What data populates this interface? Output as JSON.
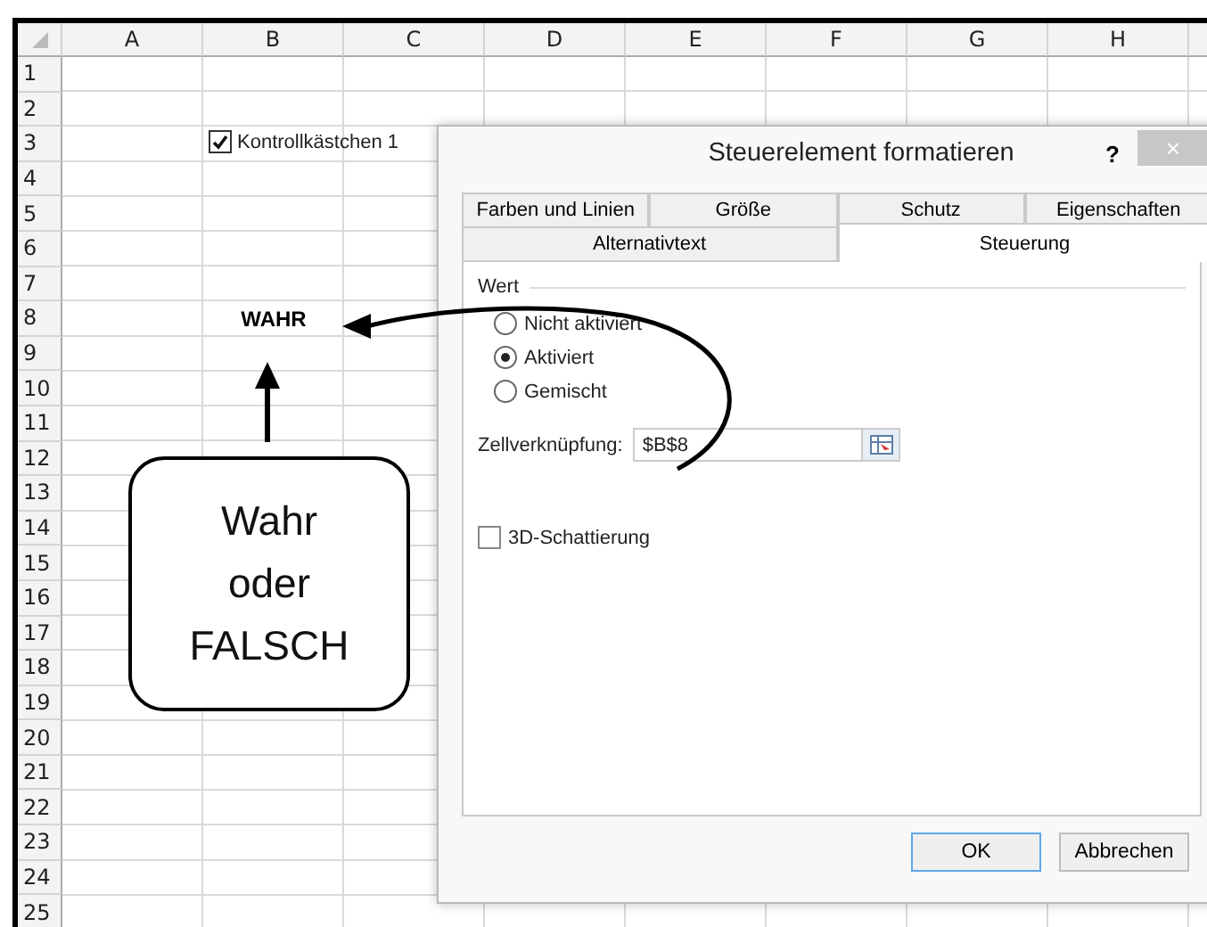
{
  "sheet": {
    "columns": [
      "A",
      "B",
      "C",
      "D",
      "E",
      "F",
      "G",
      "H"
    ],
    "rows": [
      "1",
      "2",
      "3",
      "4",
      "5",
      "6",
      "7",
      "8",
      "9",
      "10",
      "11",
      "12",
      "13",
      "14",
      "15",
      "16",
      "17",
      "18",
      "19",
      "20",
      "21",
      "22",
      "23",
      "24",
      "25"
    ],
    "checkbox_control": {
      "label": "Kontrollkästchen 1",
      "checked": true
    },
    "linked_cell": "WAHR"
  },
  "callout": {
    "lines": [
      "Wahr",
      "oder",
      "FALSCH"
    ]
  },
  "dialog": {
    "title": "Steuerelement formatieren",
    "help": "?",
    "close": "×",
    "tab_rows": [
      [
        {
          "label": "Farben und Linien",
          "selected": false
        },
        {
          "label": "Größe",
          "selected": false
        },
        {
          "label": "Schutz",
          "selected": false
        },
        {
          "label": "Eigenschaften",
          "selected": false
        }
      ],
      [
        {
          "label": "Alternativtext",
          "selected": false
        },
        {
          "label": "Steuerung",
          "selected": true
        }
      ]
    ],
    "group": "Wert",
    "radios": [
      {
        "label": "Nicht aktiviert",
        "selected": false
      },
      {
        "label": "Aktiviert",
        "selected": true
      },
      {
        "label": "Gemischt",
        "selected": false
      }
    ],
    "cell_link": {
      "label": "Zellverknüpfung:",
      "value": "$B$8"
    },
    "shading": {
      "label": "3D-Schattierung",
      "checked": false
    },
    "buttons": [
      {
        "label": "OK",
        "default": true
      },
      {
        "label": "Abbrechen",
        "default": false
      }
    ]
  }
}
